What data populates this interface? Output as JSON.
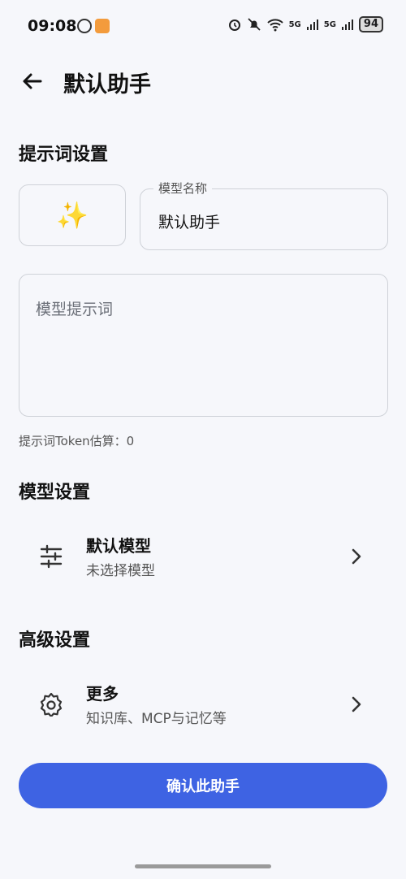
{
  "status_bar": {
    "time": "09:08",
    "battery": "94",
    "network_1": "5G",
    "network_2": "5G",
    "wifi_badge": "6"
  },
  "header": {
    "title": "默认助手"
  },
  "prompt_settings": {
    "section_title": "提示词设置",
    "avatar_emoji": "✨",
    "model_name_label": "模型名称",
    "model_name_value": "默认助手",
    "prompt_placeholder": "模型提示词",
    "token_estimate": "提示词Token估算：0"
  },
  "model_settings": {
    "section_title": "模型设置",
    "item_title": "默认模型",
    "item_subtitle": "未选择模型"
  },
  "advanced_settings": {
    "section_title": "高级设置",
    "item_title": "更多",
    "item_subtitle": "知识库、MCP与记忆等"
  },
  "confirm_button": {
    "label": "确认此助手"
  },
  "colors": {
    "accent": "#3e63e3",
    "background": "#f6f7fb"
  }
}
